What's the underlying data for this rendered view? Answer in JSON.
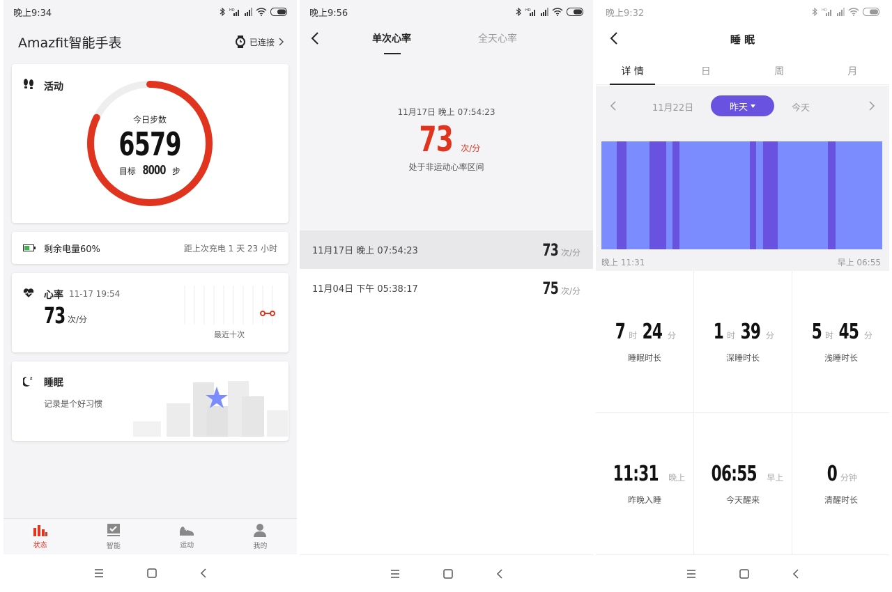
{
  "screen1": {
    "status_time": "晚上9:34",
    "header": {
      "title": "Amazfit智能手表",
      "connection": "已连接"
    },
    "activity": {
      "title": "活动",
      "steps_label": "今日步数",
      "steps": "6579",
      "goal_prefix": "目标",
      "goal_value": "8000",
      "goal_unit": "步",
      "progress": 0.822
    },
    "battery": {
      "label": "剩余电量60%",
      "since_charge": "距上次充电 1 天 23 小时",
      "level": 0.6
    },
    "heart": {
      "title": "心率",
      "time": "11-17 19:54",
      "value": "73",
      "unit": "次/分",
      "recent_label": "最近十次"
    },
    "sleep": {
      "title": "睡眠",
      "subtitle": "记录是个好习惯"
    },
    "tabs": [
      {
        "label": "状态",
        "icon": "bar-chart-icon",
        "active": true
      },
      {
        "label": "智能",
        "icon": "checklist-icon",
        "active": false
      },
      {
        "label": "运动",
        "icon": "shoe-icon",
        "active": false
      },
      {
        "label": "我的",
        "icon": "person-icon",
        "active": false
      }
    ]
  },
  "screen2": {
    "status_time": "晚上9:56",
    "tabs": [
      "单次心率",
      "全天心率"
    ],
    "latest": {
      "datetime": "11月17日 晚上 07:54:23",
      "value": "73",
      "unit": "次/分",
      "zone": "处于非运动心率区间"
    },
    "records": [
      {
        "datetime": "11月17日 晚上 07:54:23",
        "value": "73",
        "unit": "次/分"
      },
      {
        "datetime": "11月04日 下午 05:38:17",
        "value": "75",
        "unit": "次/分"
      }
    ]
  },
  "screen3": {
    "status_time": "晚上9:32",
    "title": "睡 眠",
    "tabs": [
      "详 情",
      "日",
      "周",
      "月"
    ],
    "dates": {
      "prev": "11月22日",
      "current": "昨天",
      "next": "今天"
    },
    "chart_start": "晚上 11:31",
    "chart_end": "早上 06:55",
    "chart_colors": {
      "light": "#7b8cff",
      "deep": "#6a52e0"
    },
    "metrics": [
      {
        "value": "7",
        "unit1": "时",
        "value2": "24",
        "unit2": "分",
        "label": "睡眠时长"
      },
      {
        "value": "1",
        "unit1": "时",
        "value2": "39",
        "unit2": "分",
        "label": "深睡时长"
      },
      {
        "value": "5",
        "unit1": "时",
        "value2": "45",
        "unit2": "分",
        "label": "浅睡时长"
      },
      {
        "value": "11:31",
        "unit1": "晚上",
        "value2": "",
        "unit2": "",
        "label": "昨晚入睡"
      },
      {
        "value": "06:55",
        "unit1": "早上",
        "value2": "",
        "unit2": "",
        "label": "今天醒来"
      },
      {
        "value": "0",
        "unit1": "分钟",
        "value2": "",
        "unit2": "",
        "label": "清醒时长"
      }
    ]
  },
  "colors": {
    "accent": "#e0341e",
    "purple": "#6a52e0",
    "battery": "#3cb44b"
  }
}
